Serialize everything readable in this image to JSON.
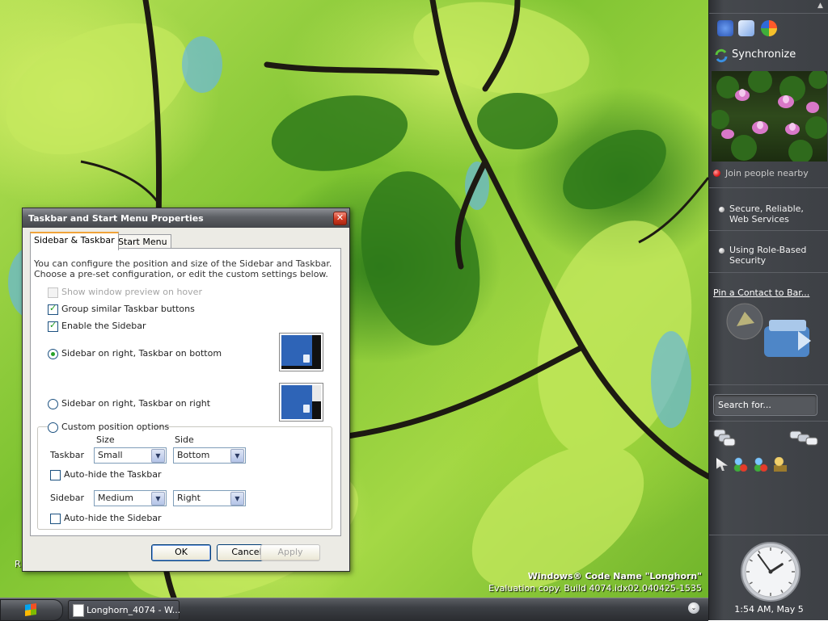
{
  "desktop": {
    "watermark_line1": "Windows® Code Name \"Longhorn\"",
    "watermark_line2": "Evaluation copy. Build 4074.idx02.040425-1535",
    "clipped_icon_label": "R"
  },
  "sidebar": {
    "sync_label": "Synchronize",
    "join_label": "Join people nearby",
    "items": [
      {
        "label_line1": "Secure, Reliable,",
        "label_line2": "Web Services"
      },
      {
        "label_line1": "Using Role-Based",
        "label_line2": "Security"
      }
    ],
    "pin_label": "Pin a Contact to Bar...",
    "search_placeholder": "Search for...",
    "clock_text": "1:54 AM, May 5",
    "clock_time": {
      "hour": 1,
      "minute": 54
    }
  },
  "taskbar": {
    "task_label": "Longhorn_4074 - W..."
  },
  "dialog": {
    "title": "Taskbar and Start Menu Properties",
    "tabs": [
      "Sidebar & Taskbar",
      "Start Menu"
    ],
    "intro_text": "You can configure the position and size of the Sidebar and Taskbar. Choose a pre-set configuration, or edit the custom settings below.",
    "checkboxes": [
      {
        "label": "Show window preview on hover",
        "checked": false,
        "disabled": true
      },
      {
        "label": "Group similar Taskbar buttons",
        "checked": true,
        "disabled": false
      },
      {
        "label": "Enable the Sidebar",
        "checked": true,
        "disabled": false
      }
    ],
    "radios": [
      {
        "label": "Sidebar on right, Taskbar on bottom",
        "selected": true
      },
      {
        "label": "Sidebar on right, Taskbar on right",
        "selected": false
      },
      {
        "label": "Custom position options",
        "selected": false
      }
    ],
    "custom": {
      "size_header": "Size",
      "side_header": "Side",
      "taskbar_label": "Taskbar",
      "taskbar_size": "Small",
      "taskbar_side": "Bottom",
      "autohide_taskbar": "Auto-hide the Taskbar",
      "sidebar_label": "Sidebar",
      "sidebar_size": "Medium",
      "sidebar_side": "Right",
      "autohide_sidebar": "Auto-hide the Sidebar"
    },
    "buttons": {
      "ok": "OK",
      "cancel": "Cancel",
      "apply": "Apply"
    }
  },
  "colors": {
    "sidebar_bg": "#3d4045",
    "titlebar": "#5c5f64",
    "preview_screen": "#2e64b7",
    "accent_tab": "#f0a33a"
  }
}
